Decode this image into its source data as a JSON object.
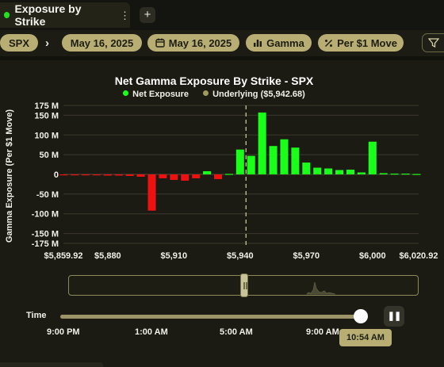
{
  "tab": {
    "title": "Exposure by Strike",
    "menu_icon": "⋮",
    "add_icon": "+",
    "status_color": "#22e01c"
  },
  "filters": {
    "symbol": "SPX",
    "separator": "›",
    "expiration": "May 16, 2025",
    "date": "May 16, 2025",
    "greek": "Gamma",
    "mode": "Per $1 Move"
  },
  "chart_data": {
    "type": "bar",
    "title": "Net Gamma Exposure By Strike - SPX",
    "ylabel": "Gamma Exposure (Per $1 Move)",
    "xlabel": "",
    "ylim": [
      -175,
      175
    ],
    "xlim": [
      5859.92,
      6020.92
    ],
    "legend": [
      {
        "name": "Net Exposure",
        "color": "#1aff1a"
      },
      {
        "name": "Underlying ($5,942.68)",
        "color": "#a09a5e"
      }
    ],
    "underlying": 5942.68,
    "yticks": [
      {
        "v": 175,
        "label": "175 M"
      },
      {
        "v": 150,
        "label": "150 M"
      },
      {
        "v": 100,
        "label": "100 M"
      },
      {
        "v": 50,
        "label": "50 M"
      },
      {
        "v": 0,
        "label": "0"
      },
      {
        "v": -50,
        "label": "-50 M"
      },
      {
        "v": -100,
        "label": "-100 M"
      },
      {
        "v": -150,
        "label": "-150 M"
      },
      {
        "v": -175,
        "label": "-175 M"
      }
    ],
    "xticks": [
      {
        "v": 5859.92,
        "label": "$5,859.92"
      },
      {
        "v": 5880,
        "label": "$5,880"
      },
      {
        "v": 5910,
        "label": "$5,910"
      },
      {
        "v": 5940,
        "label": "$5,940"
      },
      {
        "v": 5970,
        "label": "$5,970"
      },
      {
        "v": 6000,
        "label": "$6,000"
      },
      {
        "v": 6020.92,
        "label": "$6,020.92"
      }
    ],
    "strikes": [
      5860,
      5865,
      5870,
      5875,
      5880,
      5885,
      5890,
      5895,
      5900,
      5905,
      5910,
      5915,
      5920,
      5925,
      5930,
      5935,
      5940,
      5945,
      5950,
      5955,
      5960,
      5965,
      5970,
      5975,
      5980,
      5985,
      5990,
      5995,
      6000,
      6005,
      6010,
      6015,
      6020
    ],
    "values": [
      -1,
      -1,
      -2,
      -2,
      -3,
      -3,
      -4,
      -6,
      -92,
      -10,
      -14,
      -16,
      -10,
      8,
      -12,
      0,
      63,
      47,
      157,
      72,
      89,
      68,
      30,
      17,
      15,
      11,
      12,
      5,
      83,
      3,
      2,
      2,
      1
    ]
  },
  "navigator": {
    "label": "range-navigator"
  },
  "time": {
    "label": "Time",
    "ticks": [
      "9:00 PM",
      "1:00 AM",
      "5:00 AM",
      "9:00 AM"
    ],
    "current": "10:54 AM",
    "current_fraction": 0.99,
    "pause_icon": "❚❚"
  }
}
